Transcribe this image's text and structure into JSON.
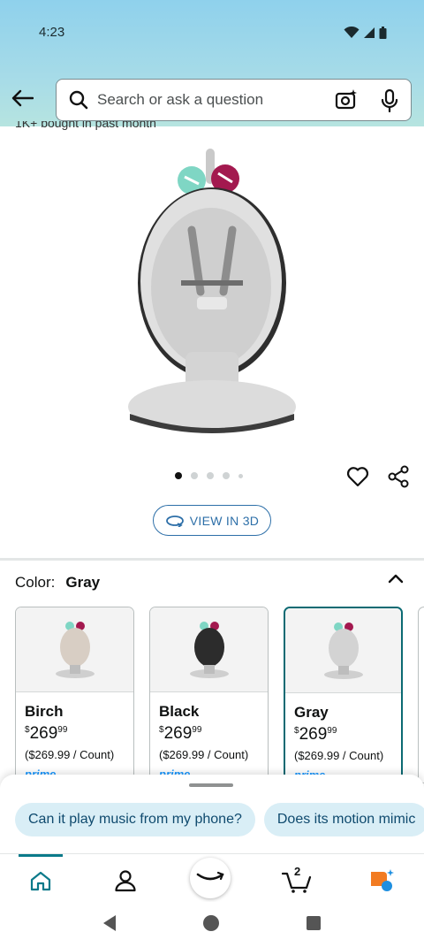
{
  "status_bar": {
    "time": "4:23"
  },
  "search": {
    "placeholder": "Search or ask a question"
  },
  "product": {
    "partial_text": "1K+ bought in past month",
    "image_count": 5,
    "active_image": 1,
    "view_3d_label": "VIEW IN 3D"
  },
  "color_selector": {
    "label": "Color:",
    "selected": "Gray",
    "options": [
      {
        "name": "Birch",
        "price_whole": "269",
        "price_fraction": "99",
        "currency": "$",
        "unit_price": "($269.99 / Count)",
        "prime": "prime"
      },
      {
        "name": "Black",
        "price_whole": "269",
        "price_fraction": "99",
        "currency": "$",
        "unit_price": "($269.99 / Count)",
        "prime": "prime"
      },
      {
        "name": "Gray",
        "price_whole": "269",
        "price_fraction": "99",
        "currency": "$",
        "unit_price": "($269.99 / Count)",
        "prime": "prime"
      }
    ]
  },
  "suggestions": [
    "Can it play music from my phone?",
    "Does its motion mimic"
  ],
  "bottom_nav": {
    "items": [
      "home-icon",
      "account-icon",
      "amazon-smile-icon",
      "cart-icon",
      "rufus-icon"
    ],
    "cart_count": "2"
  },
  "colors": {
    "accent": "#0b6a73",
    "link": "#2d6fa8",
    "prime": "#1a98ff",
    "chip_bg": "#d9eef6"
  }
}
